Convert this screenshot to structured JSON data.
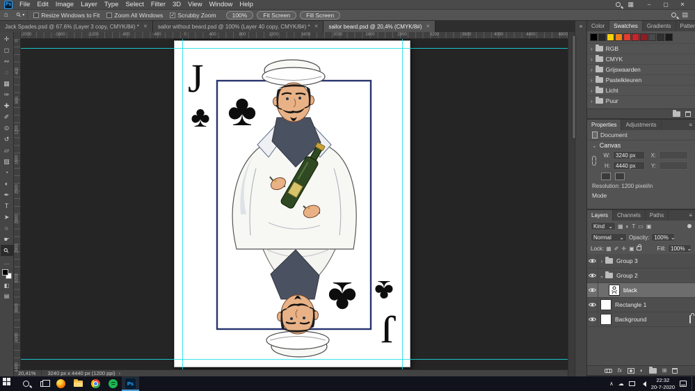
{
  "glyphs": {
    "close": "✕",
    "minimize": "–",
    "maximize": "▢",
    "home": "⌂",
    "zoom_tool": "⚲",
    "caret_down": "▾",
    "panel_menu": "≡",
    "collapse": "»",
    "chevron_right": "›",
    "chevron_down": "⌄",
    "up_chevron": "∧",
    "cloud": "☁",
    "more": "›",
    "dots": "…",
    "fx": "fx",
    "adjustment_half": "◐",
    "new_item": "⊞",
    "quick_mask": "◧",
    "screen_mode": "▤",
    "grid": "▦"
  },
  "app": {
    "logo_text": "Ps"
  },
  "menubar": {
    "items": [
      "File",
      "Edit",
      "Image",
      "Layer",
      "Type",
      "Select",
      "Filter",
      "3D",
      "View",
      "Window",
      "Help"
    ]
  },
  "options_bar": {
    "checkboxes": [
      {
        "label": "Resize Windows to Fit",
        "checked": false
      },
      {
        "label": "Zoom All Windows",
        "checked": false
      },
      {
        "label": "Scrubby Zoom",
        "checked": true
      }
    ],
    "buttons": [
      "100%",
      "Fit Screen",
      "Fill Screen"
    ]
  },
  "document_tabs": [
    {
      "title": "Jack Spades.psd @ 67.6% (Layer 3 copy, CMYK/8#) *",
      "active": false
    },
    {
      "title": "sailor without beard.psd @ 100% (Layer 40 copy, CMYK/8#) *",
      "active": false
    },
    {
      "title": "sailor beard.psd @ 20,4% (CMYK/8#)",
      "active": true
    }
  ],
  "toolbar": {
    "tools": [
      {
        "name": "move-tool",
        "glyph": "✛",
        "selected": false
      },
      {
        "name": "rectangular-marquee-tool",
        "glyph": "◻",
        "selected": false
      },
      {
        "name": "lasso-tool",
        "glyph": "∾",
        "selected": false
      },
      {
        "name": "object-selection-tool",
        "glyph": "◌",
        "selected": false
      },
      {
        "name": "crop-tool",
        "glyph": "▦",
        "selected": false
      },
      {
        "name": "eyedropper-tool",
        "glyph": "✑",
        "selected": false
      },
      {
        "name": "spot-healing-brush-tool",
        "glyph": "✚",
        "selected": false
      },
      {
        "name": "brush-tool",
        "glyph": "✐",
        "selected": false
      },
      {
        "name": "clone-stamp-tool",
        "glyph": "⊙",
        "selected": false
      },
      {
        "name": "history-brush-tool",
        "glyph": "↺",
        "selected": false
      },
      {
        "name": "eraser-tool",
        "glyph": "▱",
        "selected": false
      },
      {
        "name": "gradient-tool",
        "glyph": "▨",
        "selected": false
      },
      {
        "name": "blur-tool",
        "glyph": "◔",
        "selected": false
      },
      {
        "name": "dodge-tool",
        "glyph": "◐",
        "selected": false
      },
      {
        "name": "pen-tool",
        "glyph": "✒",
        "selected": false
      },
      {
        "name": "type-tool",
        "glyph": "T",
        "selected": false
      },
      {
        "name": "path-selection-tool",
        "glyph": "➤",
        "selected": false
      },
      {
        "name": "shape-tool",
        "glyph": "○",
        "selected": false
      },
      {
        "name": "hand-tool",
        "glyph": "☛",
        "selected": false
      },
      {
        "name": "zoom-tool",
        "glyph": "⚲",
        "selected": true
      }
    ]
  },
  "rulers": {
    "horizontal": [
      "-2000",
      "-1600",
      "-1200",
      "-800",
      "-400",
      "0",
      "400",
      "800",
      "1200",
      "1600",
      "2000",
      "2400",
      "2800",
      "3200",
      "3600",
      "4000",
      "4400",
      "4800"
    ],
    "vertical": [
      "0",
      "400",
      "800",
      "1200",
      "1600",
      "2000",
      "2400",
      "2800",
      "3200",
      "3600",
      "4000",
      "4400"
    ]
  },
  "canvas": {
    "card": {
      "rank": "J",
      "suit": "♣"
    },
    "guide_color": "#19dfe8"
  },
  "status_bar": {
    "zoom": "20,41%",
    "info": "3240 px x 4440 px (1200 ppi)"
  },
  "panels": {
    "swatches": {
      "tabs": [
        {
          "label": "Color",
          "active": false
        },
        {
          "label": "Swatches",
          "active": true
        },
        {
          "label": "Gradients",
          "active": false
        },
        {
          "label": "Patterns",
          "active": false
        }
      ],
      "swatch_colors": [
        "#000000",
        "#262626",
        "#f6d10a",
        "#ef7f1a",
        "#e23d2e",
        "#c5252c",
        "#8c1e24",
        "#4a4a4a",
        "#303030",
        "#1a1a1a"
      ],
      "groups": [
        "RGB",
        "CMYK",
        "Grijswaarden",
        "Pastelkleuren",
        "Licht",
        "Puur"
      ]
    },
    "properties": {
      "tabs": [
        {
          "label": "Properties",
          "active": true
        },
        {
          "label": "Adjustments",
          "active": false
        }
      ],
      "document_label": "Document",
      "section_label": "Canvas",
      "fields": {
        "w_label": "W:",
        "w_value": "3240 px",
        "h_label": "H:",
        "h_value": "4440 px",
        "x_label": "X:",
        "y_label": "Y:"
      },
      "resolution_label": "Resolution:",
      "resolution_value": "1200 pixel/in",
      "mode_label": "Mode"
    },
    "layers": {
      "tabs": [
        {
          "label": "Layers",
          "active": true
        },
        {
          "label": "Channels",
          "active": false
        },
        {
          "label": "Paths",
          "active": false
        }
      ],
      "filter_label": "Kind",
      "filter_icons": [
        "▦",
        "◐",
        "T",
        "▭",
        "▣"
      ],
      "blend_mode": "Normal",
      "opacity_label": "Opacity:",
      "opacity_value": "100%",
      "lock_label": "Lock:",
      "lock_icons": [
        "▦",
        "✐",
        "✛",
        "▣"
      ],
      "fill_label": "Fill:",
      "fill_value": "100%",
      "items": [
        {
          "name": "Group 3",
          "type": "group",
          "expanded": false
        },
        {
          "name": "Group 2",
          "type": "group",
          "expanded": true
        },
        {
          "name": "black",
          "type": "layer",
          "selected": true
        },
        {
          "name": "Rectangle 1",
          "type": "layer",
          "selected": false
        },
        {
          "name": "Background",
          "type": "layer",
          "locked": true
        }
      ]
    }
  },
  "taskbar": {
    "apps": [
      "start",
      "search",
      "task-view",
      "firefox",
      "file-explorer",
      "chrome",
      "spotify",
      "photoshop"
    ],
    "active_app": "photoshop",
    "time": "22:32",
    "date": "20-7-2020"
  }
}
